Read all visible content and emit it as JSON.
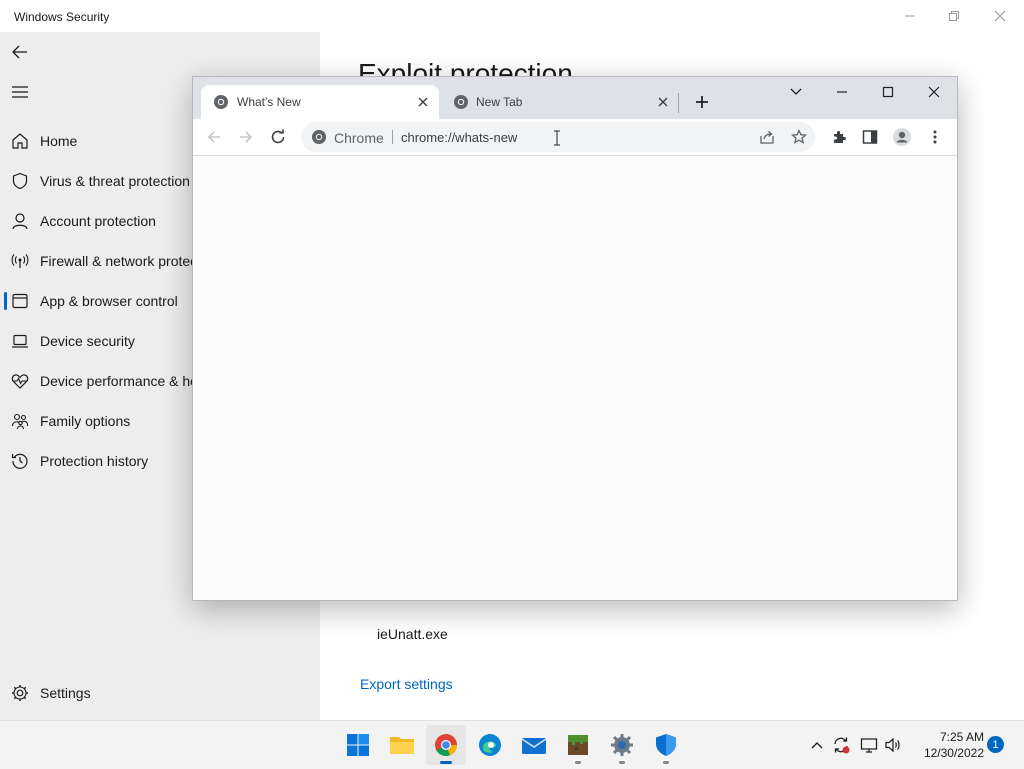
{
  "window": {
    "title": "Windows Security",
    "controls": [
      "minimize",
      "restore",
      "close"
    ]
  },
  "sidebar": {
    "back_icon": "back-arrow-icon",
    "menu_icon": "hamburger-icon",
    "items": [
      {
        "label": "Home",
        "icon": "home-icon"
      },
      {
        "label": "Virus & threat protection",
        "icon": "shield-icon"
      },
      {
        "label": "Account protection",
        "icon": "person-icon"
      },
      {
        "label": "Firewall & network protection",
        "icon": "antenna-icon"
      },
      {
        "label": "App & browser control",
        "icon": "app-window-icon",
        "active": true
      },
      {
        "label": "Device security",
        "icon": "laptop-icon"
      },
      {
        "label": "Device performance & health",
        "icon": "heart-pulse-icon"
      },
      {
        "label": "Family options",
        "icon": "family-icon"
      },
      {
        "label": "Protection history",
        "icon": "history-icon"
      }
    ],
    "settings": {
      "label": "Settings",
      "icon": "gear-icon"
    }
  },
  "main": {
    "heading": "Exploit protection",
    "file_item": "ieUnatt.exe",
    "export_link": "Export settings"
  },
  "browser": {
    "tabs": [
      {
        "title": "What's New",
        "active": true
      },
      {
        "title": "New Tab",
        "active": false
      }
    ],
    "new_tab_icon": "plus-icon",
    "omnibox": {
      "chip": "Chrome",
      "url": "chrome://whats-new"
    },
    "toolbar_icons": [
      "back-icon",
      "forward-icon",
      "reload-icon",
      "share-icon",
      "bookmark-star-icon",
      "extensions-icon",
      "side-panel-icon",
      "profile-icon",
      "more-menu-icon"
    ]
  },
  "taskbar": {
    "apps": [
      "start",
      "file-explorer",
      "chrome",
      "edge",
      "mail",
      "minecraft",
      "settings",
      "windows-security"
    ],
    "clock": {
      "time": "7:25 AM",
      "date": "12/30/2022"
    },
    "notification_count": "1"
  },
  "colors": {
    "accent": "#0067c0",
    "sidebar_bg": "#ededed",
    "tabstrip_bg": "#dee1e6",
    "taskbar_bg": "#f3f3f3"
  }
}
